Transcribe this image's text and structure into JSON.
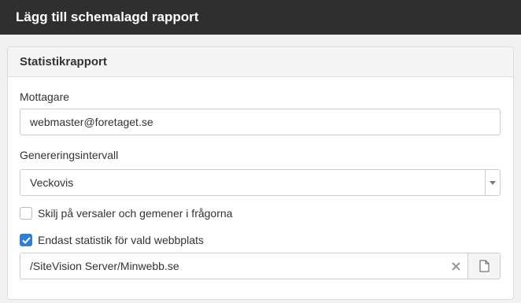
{
  "dialog": {
    "title": "Lägg till schemalagd rapport"
  },
  "panel": {
    "heading": "Statistikrapport"
  },
  "recipient": {
    "label": "Mottagare",
    "value": "webmaster@foretaget.se"
  },
  "interval": {
    "label": "Genereringsintervall",
    "selected": "Veckovis"
  },
  "case_sensitive": {
    "label": "Skilj på versaler och gemener i frågorna",
    "checked": false
  },
  "site_only": {
    "label": "Endast statistik för vald webbplats",
    "checked": true
  },
  "site_path": {
    "value": "/SiteVision Server/Minwebb.se"
  },
  "icons": {
    "clear": "close-icon",
    "file": "file-icon",
    "arrow": "chevron-down-icon",
    "check": "checkmark-icon"
  },
  "colors": {
    "titlebar": "#2f2f2f",
    "accent": "#2f7fd3"
  }
}
